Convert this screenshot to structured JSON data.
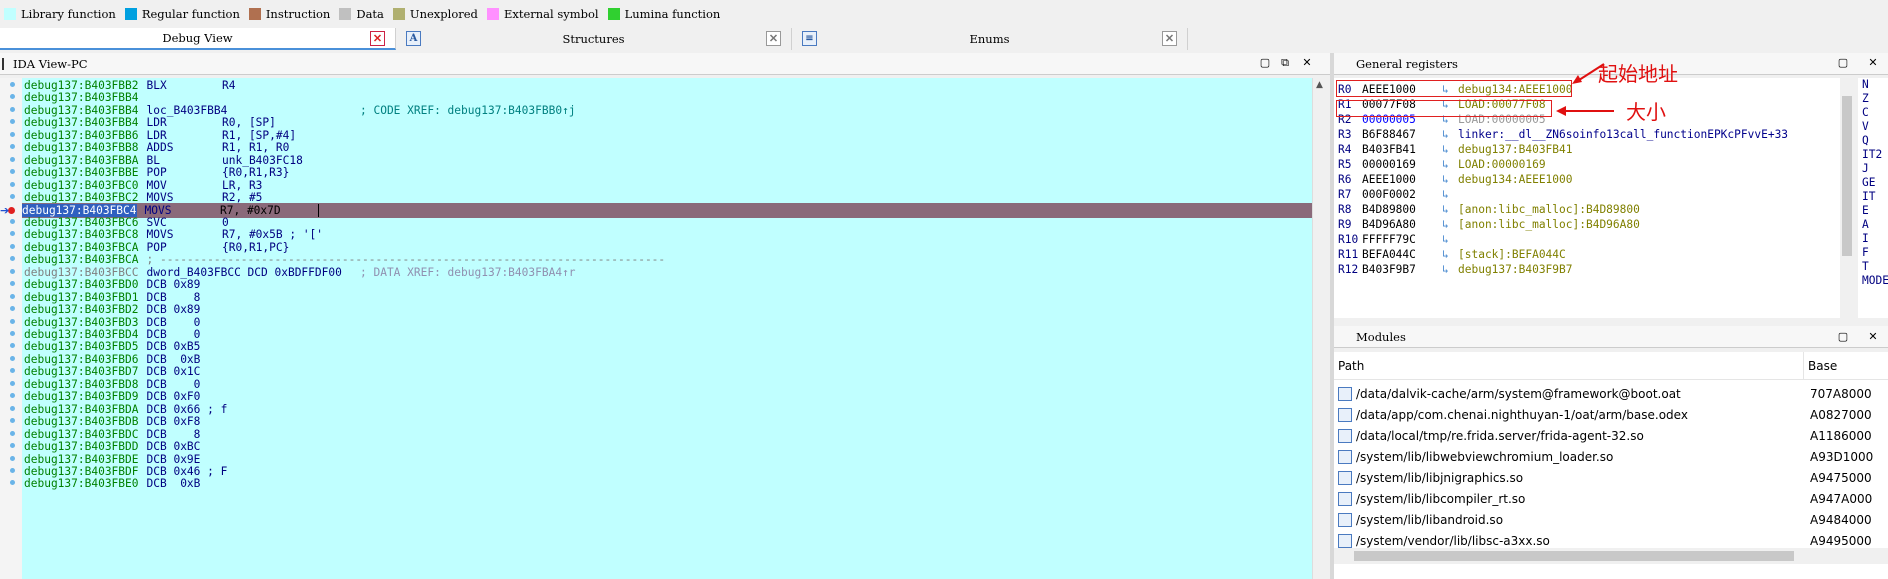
{
  "legend": [
    {
      "label": "Library function",
      "color": "#c0ffff"
    },
    {
      "label": "Regular function",
      "color": "#00a0e0"
    },
    {
      "label": "Instruction",
      "color": "#b07050"
    },
    {
      "label": "Data",
      "color": "#c0c0c0"
    },
    {
      "label": "Unexplored",
      "color": "#b0b070"
    },
    {
      "label": "External symbol",
      "color": "#ff90ff"
    },
    {
      "label": "Lumina function",
      "color": "#30d030"
    }
  ],
  "tabs": [
    {
      "label": "Debug View",
      "active": true
    },
    {
      "label": "Structures",
      "active": false,
      "icon": "A"
    },
    {
      "label": "Enums",
      "active": false,
      "icon": "enum"
    }
  ],
  "ida_view": {
    "title": "IDA View-PC",
    "lines": [
      {
        "addr": "debug137:B403FBB2",
        "mn": "BLX",
        "op": "R4",
        "cmt": ""
      },
      {
        "addr": "debug137:B403FBB4",
        "mn": "",
        "op": "",
        "cmt": ""
      },
      {
        "addr": "debug137:B403FBB4",
        "mn": "loc_B403FBB4",
        "op": "",
        "cmt": "; CODE XREF: debug137:B403FBB0↑j"
      },
      {
        "addr": "debug137:B403FBB4",
        "mn": "LDR",
        "op": "R0, [SP]",
        "cmt": ""
      },
      {
        "addr": "debug137:B403FBB6",
        "mn": "LDR",
        "op": "R1, [SP,#4]",
        "cmt": ""
      },
      {
        "addr": "debug137:B403FBB8",
        "mn": "ADDS",
        "op": "R1, R1, R0",
        "cmt": ""
      },
      {
        "addr": "debug137:B403FBBA",
        "mn": "BL",
        "op": "unk_B403FC18",
        "cmt": ""
      },
      {
        "addr": "debug137:B403FBBE",
        "mn": "POP",
        "op": "{R0,R1,R3}",
        "cmt": ""
      },
      {
        "addr": "debug137:B403FBC0",
        "mn": "MOV",
        "op": "LR, R3",
        "cmt": ""
      },
      {
        "addr": "debug137:B403FBC2",
        "mn": "MOVS",
        "op": "R2, #5",
        "cmt": ""
      },
      {
        "addr": "debug137:B403FBC4",
        "mn": "MOVS",
        "op": "R7, #0x7D",
        "cmt": "",
        "current": true
      },
      {
        "addr": "debug137:B403FBC6",
        "mn": "SVC",
        "op": "0",
        "cmt": ""
      },
      {
        "addr": "debug137:B403FBC8",
        "mn": "MOVS",
        "op": "R7, #0x5B ; '['",
        "cmt": ""
      },
      {
        "addr": "debug137:B403FBCA",
        "mn": "POP",
        "op": "{R0,R1,PC}",
        "cmt": ""
      },
      {
        "addr": "debug137:B403FBCA",
        "mn": "; ---------------------------------------------------------------------------",
        "op": "",
        "cmt": ""
      },
      {
        "addr": "debug137:B403FBCC",
        "mn": "dword_B403FBCC DCD 0xBDFFDF00",
        "op": "",
        "cmt": "; DATA XREF: debug137:B403FBA4↑r",
        "grey": true
      },
      {
        "addr": "debug137:B403FBD0",
        "mn": "DCB 0x89",
        "op": "",
        "cmt": ""
      },
      {
        "addr": "debug137:B403FBD1",
        "mn": "DCB    8",
        "op": "",
        "cmt": ""
      },
      {
        "addr": "debug137:B403FBD2",
        "mn": "DCB 0x89",
        "op": "",
        "cmt": ""
      },
      {
        "addr": "debug137:B403FBD3",
        "mn": "DCB    0",
        "op": "",
        "cmt": ""
      },
      {
        "addr": "debug137:B403FBD4",
        "mn": "DCB    0",
        "op": "",
        "cmt": ""
      },
      {
        "addr": "debug137:B403FBD5",
        "mn": "DCB 0xB5",
        "op": "",
        "cmt": ""
      },
      {
        "addr": "debug137:B403FBD6",
        "mn": "DCB  0xB",
        "op": "",
        "cmt": ""
      },
      {
        "addr": "debug137:B403FBD7",
        "mn": "DCB 0x1C",
        "op": "",
        "cmt": ""
      },
      {
        "addr": "debug137:B403FBD8",
        "mn": "DCB    0",
        "op": "",
        "cmt": ""
      },
      {
        "addr": "debug137:B403FBD9",
        "mn": "DCB 0xF0",
        "op": "",
        "cmt": ""
      },
      {
        "addr": "debug137:B403FBDA",
        "mn": "DCB 0x66 ; f",
        "op": "",
        "cmt": ""
      },
      {
        "addr": "debug137:B403FBDB",
        "mn": "DCB 0xF8",
        "op": "",
        "cmt": ""
      },
      {
        "addr": "debug137:B403FBDC",
        "mn": "DCB    8",
        "op": "",
        "cmt": ""
      },
      {
        "addr": "debug137:B403FBDD",
        "mn": "DCB 0xBC",
        "op": "",
        "cmt": ""
      },
      {
        "addr": "debug137:B403FBDE",
        "mn": "DCB 0x9E",
        "op": "",
        "cmt": ""
      },
      {
        "addr": "debug137:B403FBDF",
        "mn": "DCB 0x46 ; F",
        "op": "",
        "cmt": ""
      },
      {
        "addr": "debug137:B403FBE0",
        "mn": "DCB  0xB",
        "op": "",
        "cmt": ""
      }
    ]
  },
  "registers": {
    "title": "General registers",
    "rows": [
      {
        "name": "R0",
        "value": "AEEE1000",
        "sym": "debug134:AEEE1000",
        "kind": "olive"
      },
      {
        "name": "R1",
        "value": "00077F08",
        "sym": "LOAD:00077F08",
        "kind": "olive"
      },
      {
        "name": "R2",
        "value": "00000005",
        "sym": "LOAD:00000005",
        "kind": "grey",
        "changed": true
      },
      {
        "name": "R3",
        "value": "B6F88467",
        "sym": "linker:__dl__ZN6soinfo13call_functionEPKcPFvvE+33",
        "kind": "blue"
      },
      {
        "name": "R4",
        "value": "B403FB41",
        "sym": "debug137:B403FB41",
        "kind": "olive"
      },
      {
        "name": "R5",
        "value": "00000169",
        "sym": "LOAD:00000169",
        "kind": "olive"
      },
      {
        "name": "R6",
        "value": "AEEE1000",
        "sym": "debug134:AEEE1000",
        "kind": "olive"
      },
      {
        "name": "R7",
        "value": "000F0002",
        "sym": "",
        "kind": "olive"
      },
      {
        "name": "R8",
        "value": "B4D89800",
        "sym": "[anon:libc_malloc]:B4D89800",
        "kind": "olive"
      },
      {
        "name": "R9",
        "value": "B4D96A80",
        "sym": "[anon:libc_malloc]:B4D96A80",
        "kind": "olive"
      },
      {
        "name": "R10",
        "value": "FFFFF79C",
        "sym": "",
        "kind": "olive"
      },
      {
        "name": "R11",
        "value": "BEFA044C",
        "sym": "[stack]:BEFA044C",
        "kind": "olive"
      },
      {
        "name": "R12",
        "value": "B403F9B7",
        "sym": "debug137:B403F9B7",
        "kind": "olive"
      }
    ],
    "flags": [
      "N",
      "Z",
      "C",
      "V",
      "Q",
      "IT2",
      "J",
      "GE",
      "IT",
      "E",
      "A",
      "I",
      "F",
      "T",
      "MODE"
    ]
  },
  "annotations": {
    "start_label": "起始地址",
    "size_label": "大小"
  },
  "modules": {
    "title": "Modules",
    "col_path": "Path",
    "col_base": "Base",
    "rows": [
      {
        "path": "/data/dalvik-cache/arm/system@framework@boot.oat",
        "base": "707A8000"
      },
      {
        "path": "/data/app/com.chenai.nighthuyan-1/oat/arm/base.odex",
        "base": "A0827000"
      },
      {
        "path": "/data/local/tmp/re.frida.server/frida-agent-32.so",
        "base": "A1186000"
      },
      {
        "path": "/system/lib/libwebviewchromium_loader.so",
        "base": "A93D1000"
      },
      {
        "path": "/system/lib/libjnigraphics.so",
        "base": "A9475000"
      },
      {
        "path": "/system/lib/libcompiler_rt.so",
        "base": "A947A000"
      },
      {
        "path": "/system/lib/libandroid.so",
        "base": "A9484000"
      },
      {
        "path": "/system/vendor/lib/libsc-a3xx.so",
        "base": "A9495000"
      }
    ]
  }
}
